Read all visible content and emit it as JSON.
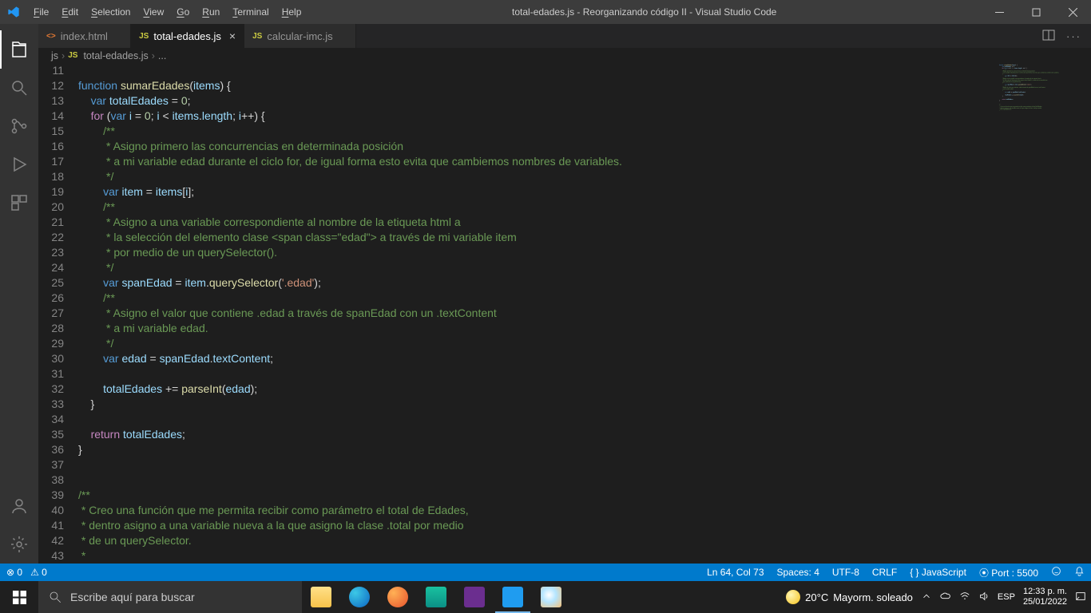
{
  "titlebar": {
    "menus": [
      "File",
      "Edit",
      "Selection",
      "View",
      "Go",
      "Run",
      "Terminal",
      "Help"
    ],
    "title": "total-edades.js - Reorganizando código II - Visual Studio Code"
  },
  "tabs": [
    {
      "icon": "<>",
      "iconClass": "html-icon",
      "label": "index.html",
      "active": false
    },
    {
      "icon": "JS",
      "iconClass": "js-icon",
      "label": "total-edades.js",
      "active": true
    },
    {
      "icon": "JS",
      "iconClass": "js-icon",
      "label": "calcular-imc.js",
      "active": false
    }
  ],
  "breadcrumbs": {
    "folder": "js",
    "icon": "JS",
    "file": "total-edades.js",
    "rest": "..."
  },
  "code": {
    "startLine": 11,
    "lines": [
      {
        "n": 11,
        "h": ""
      },
      {
        "n": 12,
        "h": "<span class='kw'>function</span> <span class='fn'>sumarEdades</span>(<span class='vr'>items</span>) {"
      },
      {
        "n": 13,
        "h": "    <span class='kw'>var</span> <span class='vr'>totalEdades</span> = <span class='nm'>0</span>;"
      },
      {
        "n": 14,
        "h": "    <span class='ctl'>for</span> (<span class='kw'>var</span> <span class='vr'>i</span> = <span class='nm'>0</span>; <span class='vr'>i</span> &lt; <span class='vr'>items</span>.<span class='vr'>length</span>; <span class='vr'>i</span>++) {"
      },
      {
        "n": 15,
        "h": "        <span class='cm'>/**</span>"
      },
      {
        "n": 16,
        "h": "<span class='cm'>         * Asigno primero las concurrencias en determinada posición</span>"
      },
      {
        "n": 17,
        "h": "<span class='cm'>         * a mi variable edad durante el ciclo for, de igual forma esto evita que cambiemos nombres de variables.</span>"
      },
      {
        "n": 18,
        "h": "<span class='cm'>         */</span>"
      },
      {
        "n": 19,
        "h": "        <span class='kw'>var</span> <span class='vr'>item</span> = <span class='vr'>items</span>[<span class='vr'>i</span>];"
      },
      {
        "n": 20,
        "h": "        <span class='cm'>/**</span>"
      },
      {
        "n": 21,
        "h": "<span class='cm'>         * Asigno a una variable correspondiente al nombre de la etiqueta html a</span>"
      },
      {
        "n": 22,
        "h": "<span class='cm'>         * la selección del elemento clase &lt;span class=&quot;edad&quot;&gt; a través de mi variable item</span>"
      },
      {
        "n": 23,
        "h": "<span class='cm'>         * por medio de un querySelector().</span>"
      },
      {
        "n": 24,
        "h": "<span class='cm'>         */</span>"
      },
      {
        "n": 25,
        "h": "        <span class='kw'>var</span> <span class='vr'>spanEdad</span> = <span class='vr'>item</span>.<span class='fn'>querySelector</span>(<span class='st'>'.edad'</span>);"
      },
      {
        "n": 26,
        "h": "        <span class='cm'>/**</span>"
      },
      {
        "n": 27,
        "h": "<span class='cm'>         * Asigno el valor que contiene .edad a través de spanEdad con un .textContent</span>"
      },
      {
        "n": 28,
        "h": "<span class='cm'>         * a mi variable edad.</span>"
      },
      {
        "n": 29,
        "h": "<span class='cm'>         */</span>"
      },
      {
        "n": 30,
        "h": "        <span class='kw'>var</span> <span class='vr'>edad</span> = <span class='vr'>spanEdad</span>.<span class='vr'>textContent</span>;"
      },
      {
        "n": 31,
        "h": ""
      },
      {
        "n": 32,
        "h": "        <span class='vr'>totalEdades</span> += <span class='fn'>parseInt</span>(<span class='vr'>edad</span>);"
      },
      {
        "n": 33,
        "h": "    }"
      },
      {
        "n": 34,
        "h": ""
      },
      {
        "n": 35,
        "h": "    <span class='ctl'>return</span> <span class='vr'>totalEdades</span>;"
      },
      {
        "n": 36,
        "h": "}"
      },
      {
        "n": 37,
        "h": ""
      },
      {
        "n": 38,
        "h": ""
      },
      {
        "n": 39,
        "h": "<span class='cm'>/**</span>"
      },
      {
        "n": 40,
        "h": "<span class='cm'> * Creo una función que me permita recibir como parámetro el total de Edades,</span>"
      },
      {
        "n": 41,
        "h": "<span class='cm'> * dentro asigno a una variable nueva a la que asigno la clase .total por medio</span>"
      },
      {
        "n": 42,
        "h": "<span class='cm'> * de un querySelector.</span>"
      },
      {
        "n": 43,
        "h": "<span class='cm'> *</span>"
      }
    ]
  },
  "status": {
    "errors": "0",
    "warnings": "0",
    "lncol": "Ln 64, Col 73",
    "spaces": "Spaces: 4",
    "enc": "UTF-8",
    "eol": "CRLF",
    "lang": "JavaScript",
    "port": "Port : 5500"
  },
  "taskbar": {
    "searchPlaceholder": "Escribe aquí para buscar",
    "weather": {
      "temp": "20°C",
      "desc": "Mayorm. soleado"
    },
    "lang": "ESP",
    "time": "12:33 p. m.",
    "date": "25/01/2022"
  }
}
